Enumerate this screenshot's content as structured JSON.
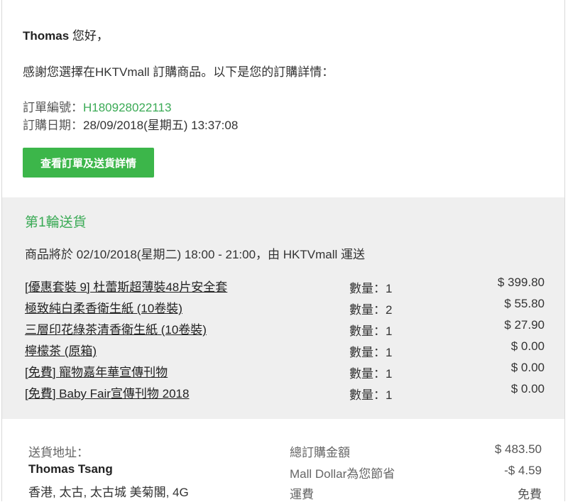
{
  "greeting": {
    "name": "Thomas",
    "suffix": " 您好，"
  },
  "intro": "感謝您選擇在HKTVmall 訂購商品。以下是您的訂購詳情：",
  "order": {
    "number_label": "訂單編號：",
    "number": "H180928022113",
    "date_label": "訂購日期：",
    "date": "28/09/2018(星期五) 13:37:08"
  },
  "button_label": "查看訂單及送貨詳情",
  "delivery": {
    "title": "第1輪送貨",
    "info": "商品將於 02/10/2018(星期二) 18:00 - 21:00，由 HKTVmall 運送",
    "items": [
      {
        "name": "[優惠套裝 9] 杜蕾斯超薄裝48片安全套",
        "qty": "數量：1",
        "price": "$ 399.80"
      },
      {
        "name": "極致純白柔香衛生紙 (10卷裝)",
        "qty": "數量：2",
        "price": "$ 55.80"
      },
      {
        "name": "三層印花綠茶清香衛生紙 (10卷裝)",
        "qty": "數量：1",
        "price": "$ 27.90"
      },
      {
        "name": "檸檬茶 (原箱)",
        "qty": "數量：1",
        "price": "$ 0.00"
      },
      {
        "name": "[免費] 寵物嘉年華宣傳刊物",
        "qty": "數量：1",
        "price": "$ 0.00"
      },
      {
        "name": "[免費] Baby Fair宣傳刊物 2018",
        "qty": "數量：1",
        "price": "$ 0.00"
      }
    ]
  },
  "address": {
    "label": "送貨地址：",
    "name": "Thomas Tsang",
    "line": "香港, 太古, 太古城 美菊閣, 4G"
  },
  "summary": {
    "total_label": "總訂購金額",
    "total_value": "$ 483.50",
    "mall_dollar_label": "Mall Dollar為您節省",
    "mall_dollar_value": "-$ 4.59",
    "shipping_label": "運費",
    "shipping_value": "免費"
  },
  "colors": {
    "accent_green": "#3aaa55",
    "button_green": "#3cb64a",
    "panel_gray": "#efefef"
  }
}
